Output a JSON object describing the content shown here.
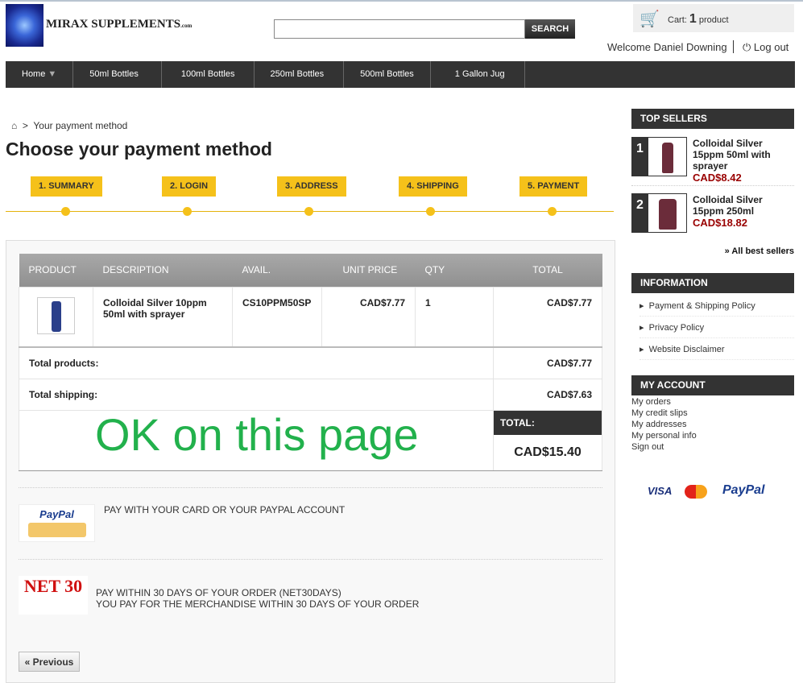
{
  "header": {
    "brand": "MIRAX SUPPLEMENTS",
    "brand_suffix": ".com",
    "search_placeholder": "",
    "search_button": "SEARCH",
    "cart_label": "Cart:",
    "cart_count": "1",
    "cart_unit": "product",
    "welcome": "Welcome Daniel Downing",
    "logout": "Log out"
  },
  "nav": [
    "Home",
    "50ml Bottles",
    "100ml Bottles",
    "250ml Bottles",
    "500ml Bottles",
    "1 Gallon Jug"
  ],
  "breadcrumb": {
    "current": "Your payment method"
  },
  "title": "Choose your payment method",
  "steps": [
    "1. SUMMARY",
    "2. LOGIN",
    "3. ADDRESS",
    "4. SHIPPING",
    "5. PAYMENT"
  ],
  "table": {
    "headers": [
      "PRODUCT",
      "DESCRIPTION",
      "AVAIL.",
      "UNIT PRICE",
      "QTY",
      "TOTAL"
    ],
    "row": {
      "description": "Colloidal Silver 10ppm 50ml with sprayer",
      "ref": "CS10PPM50SP",
      "unit_price": "CAD$7.77",
      "qty": "1",
      "total": "CAD$7.77"
    },
    "total_products_label": "Total products:",
    "total_products": "CAD$7.77",
    "total_shipping_label": "Total shipping:",
    "total_shipping": "CAD$7.63",
    "total_label": "TOTAL:",
    "total": "CAD$15.40"
  },
  "annotation": "OK on this page",
  "payment": {
    "paypal": "PAY WITH YOUR CARD OR YOUR PAYPAL ACCOUNT",
    "paypal_logo": "PayPal",
    "net30_logo": "NET 30",
    "net30_line1": "PAY WITHIN 30 DAYS OF YOUR ORDER (NET30DAYS)",
    "net30_line2": "YOU PAY FOR THE MERCHANDISE WITHIN 30 DAYS OF YOUR ORDER"
  },
  "previous": "« Previous",
  "sidebar": {
    "top_sellers": "TOP SELLERS",
    "items": [
      {
        "rank": "1",
        "name": "Colloidal Silver 15ppm 50ml with sprayer",
        "price": "CAD$8.42"
      },
      {
        "rank": "2",
        "name": "Colloidal Silver 15ppm 250ml",
        "price": "CAD$18.82"
      }
    ],
    "all_best": "» All best sellers",
    "information": "INFORMATION",
    "info_links": [
      "Payment & Shipping Policy",
      "Privacy Policy",
      "Website Disclaimer"
    ],
    "my_account": "MY ACCOUNT",
    "account_links": [
      "My orders",
      "My credit slips",
      "My addresses",
      "My personal info",
      "Sign out"
    ],
    "logos": [
      "VISA",
      "MasterCard",
      "PayPal"
    ]
  }
}
